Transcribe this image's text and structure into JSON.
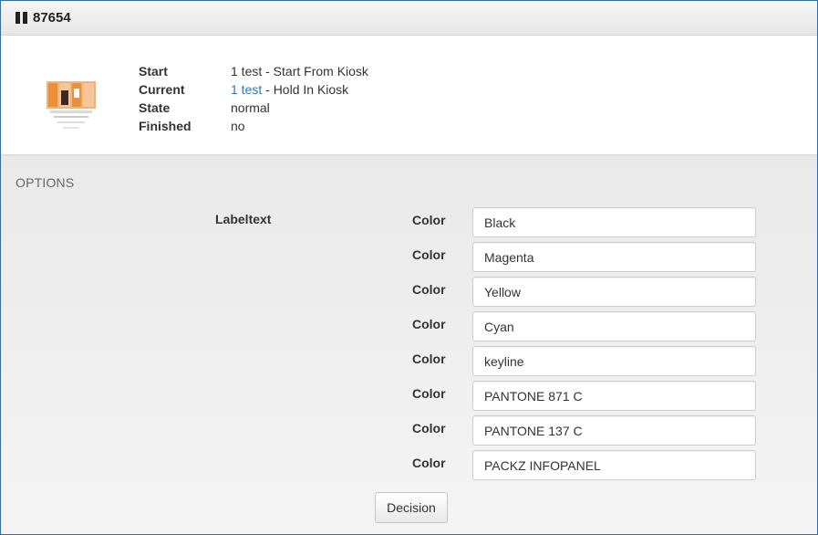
{
  "header": {
    "title": "87654",
    "status_icon": "pause-icon"
  },
  "info": {
    "rows": [
      {
        "label": "Start",
        "value": "1 test - Start From Kiosk"
      },
      {
        "label": "Current",
        "link": "1 test",
        "value": " - Hold In Kiosk"
      },
      {
        "label": "State",
        "value": "normal"
      },
      {
        "label": "Finished",
        "value": "no"
      }
    ]
  },
  "options": {
    "title": "OPTIONS",
    "group_label": "Labeltext",
    "fields": [
      {
        "label": "Color",
        "value": "Black"
      },
      {
        "label": "Color",
        "value": "Magenta"
      },
      {
        "label": "Color",
        "value": "Yellow"
      },
      {
        "label": "Color",
        "value": "Cyan"
      },
      {
        "label": "Color",
        "value": "keyline"
      },
      {
        "label": "Color",
        "value": "PANTONE 871 C"
      },
      {
        "label": "Color",
        "value": "PANTONE 137 C"
      },
      {
        "label": "Color",
        "value": "PACKZ INFOPANEL"
      }
    ],
    "decision_label": "Decision"
  },
  "colors": {
    "frame_border": "#2b6fb8",
    "link": "#2a7ac0",
    "thumbnail_accent": "#e8903c"
  }
}
